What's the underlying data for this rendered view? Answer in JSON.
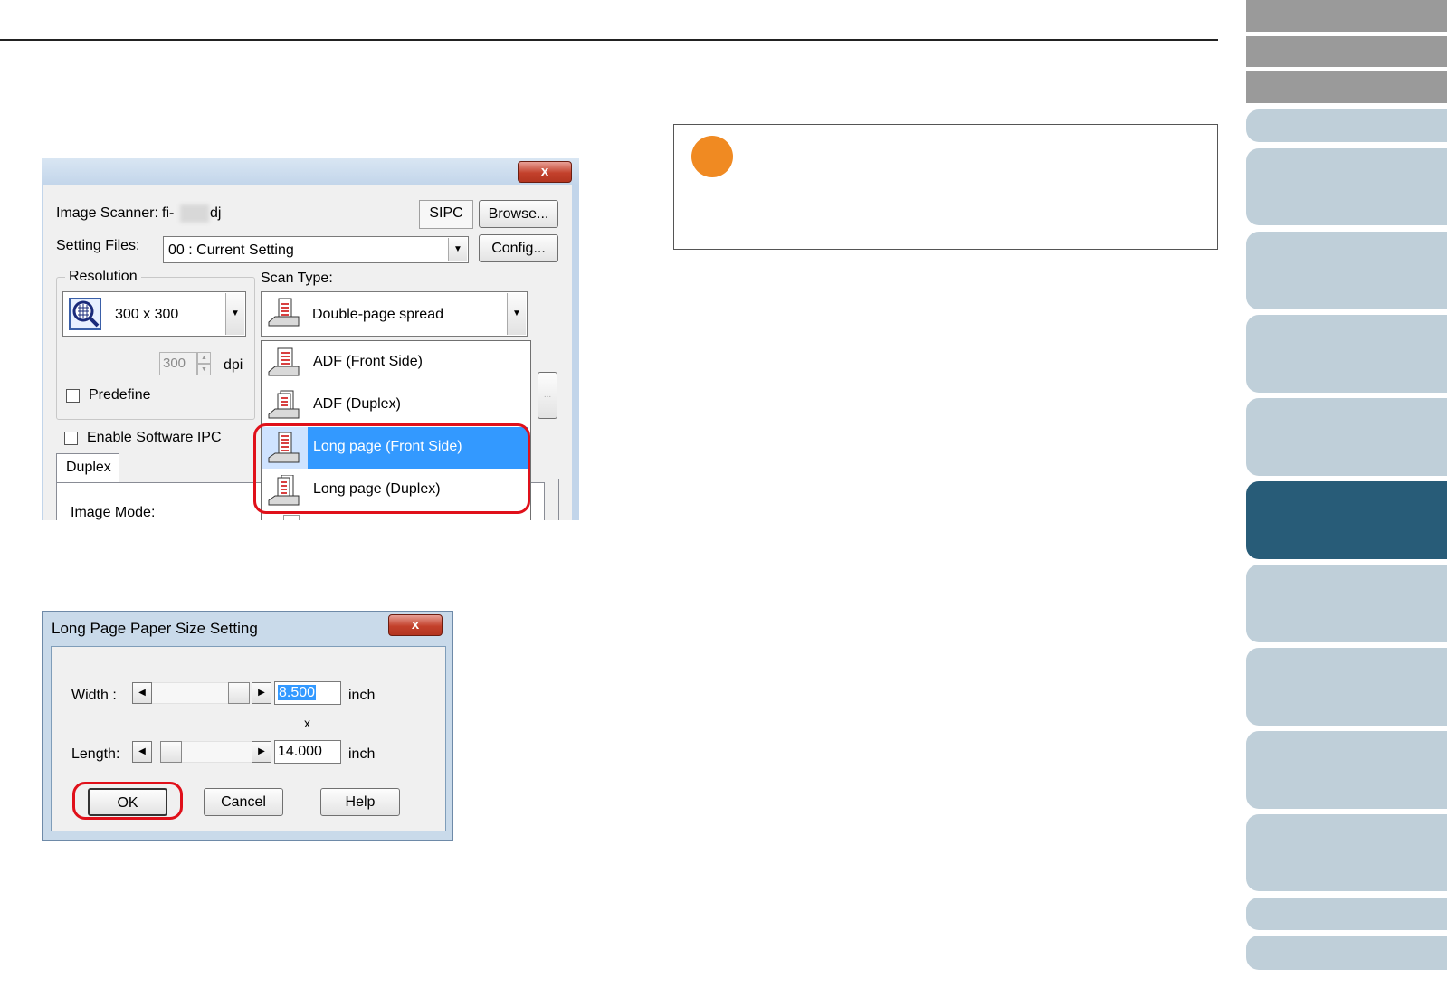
{
  "driver_dialog": {
    "close_glyph": "x",
    "scanner_label": "Image Scanner:",
    "scanner_name_prefix": "fi-",
    "scanner_name_suffix": "dj",
    "sipc_badge": "SIPC",
    "browse_button": "Browse...",
    "setting_files_label": "Setting Files:",
    "setting_files_value": "00 : Current Setting",
    "config_button": "Config...",
    "resolution_group": "Resolution",
    "resolution_value": "300 x 300",
    "dpi_value": "300",
    "dpi_unit": "dpi",
    "predefine_label": "Predefine",
    "scan_type_label": "Scan Type:",
    "scan_type_value": "Double-page spread",
    "scan_type_options": [
      "ADF (Front Side)",
      "ADF (Duplex)",
      "Long page (Front Side)",
      "Long page (Duplex)"
    ],
    "selected_option": "Long page (Front Side)",
    "enable_ipc_label": "Enable Software IPC",
    "duplex_tab": "Duplex",
    "image_mode_label": "Image Mode:",
    "ellipsis_button": "..."
  },
  "long_page_dialog": {
    "title": "Long Page Paper Size Setting",
    "close_glyph": "x",
    "width_label": "Width :",
    "width_value": "8.500",
    "length_label": "Length:",
    "length_value": "14.000",
    "times_sign": "x",
    "unit": "inch",
    "ok_button": "OK",
    "cancel_button": "Cancel",
    "help_button": "Help"
  },
  "colors": {
    "highlight_red": "#e0101a",
    "note_orange": "#f08a22",
    "nav_active": "#285c78",
    "nav_light": "#bfcfd9",
    "nav_grey": "#9a9a9a",
    "selection_blue": "#3399ff"
  }
}
